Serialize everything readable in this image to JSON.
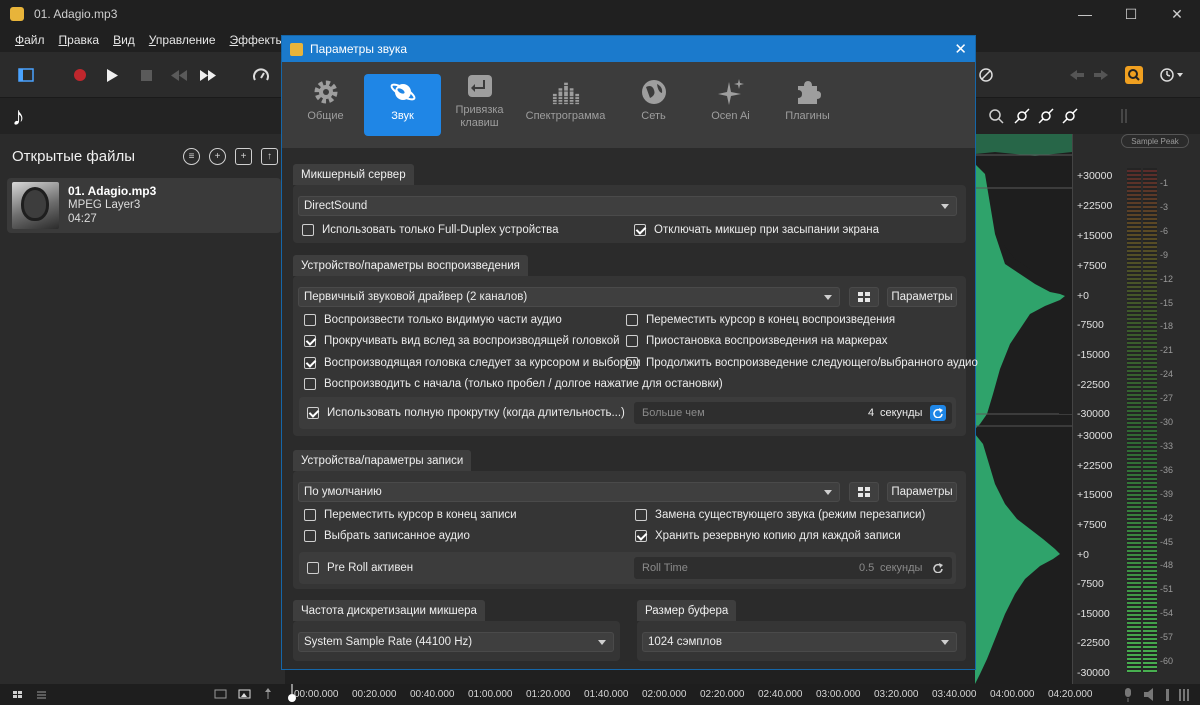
{
  "window": {
    "title": "01. Adagio.mp3",
    "min": "—",
    "max": "☐",
    "close": "✕"
  },
  "menu": [
    "Файл",
    "Правка",
    "Вид",
    "Управление",
    "Эффекты"
  ],
  "left_panel": {
    "title": "Открытые файлы",
    "file": {
      "name": "01. Adagio.mp3",
      "format": "MPEG Layer3",
      "duration": "04:27"
    }
  },
  "dialog": {
    "title": "Параметры звука",
    "close": "✕",
    "tabs": [
      {
        "label": "Общие",
        "icon": "gear-icon",
        "active": false
      },
      {
        "label": "Звук",
        "icon": "planet-icon",
        "active": true
      },
      {
        "label": "Привязка клавиш",
        "icon": "enter-key-icon",
        "active": false
      },
      {
        "label": "Спектрограмма",
        "icon": "spectrogram-icon",
        "active": false
      },
      {
        "label": "Сеть",
        "icon": "globe-icon",
        "active": false
      },
      {
        "label": "Ocen Ai",
        "icon": "sparkle-icon",
        "active": false
      },
      {
        "label": "Плагины",
        "icon": "puzzle-icon",
        "active": false
      }
    ],
    "mixer": {
      "header": "Микшерный сервер",
      "server": "DirectSound",
      "full_duplex": {
        "label": "Использовать только Full-Duplex устройства",
        "checked": false
      },
      "sleep_off": {
        "label": "Отключать микшер при засыпании экрана",
        "checked": true
      }
    },
    "playback": {
      "header": "Устройство/параметры воспроизведения",
      "device": "Первичный звуковой драйвер (2 каналов)",
      "params_button": "Параметры",
      "options_left": [
        {
          "label": "Воспроизвести только видимую части аудио",
          "checked": false
        },
        {
          "label": "Прокручивать вид вслед за воспроизводящей головкой",
          "checked": true
        },
        {
          "label": "Воспроизводящая головка следует за курсором и выбором",
          "checked": true
        },
        {
          "label": "Воспроизводить с начала (только пробел / долгое нажатие для остановки)",
          "checked": false
        }
      ],
      "options_right": [
        {
          "label": "Переместить курсор в конец воспроизведения",
          "checked": false
        },
        {
          "label": "Приостановка воспроизведения на маркерах",
          "checked": false
        },
        {
          "label": "Продолжить воспроизведение следующего/выбранного аудио",
          "checked": false
        }
      ],
      "full_scroll": {
        "label": "Использовать полную прокрутку (когда длительность...)",
        "checked": true
      },
      "more_than": "Больше чем",
      "seconds_value": "4",
      "seconds_unit": "секунды"
    },
    "record": {
      "header": "Устройства/параметры записи",
      "device": "По умолчанию",
      "params_button": "Параметры",
      "move_cursor": {
        "label": "Переместить курсор в конец записи",
        "checked": false
      },
      "select_recorded": {
        "label": "Выбрать записанное аудио",
        "checked": false
      },
      "overwrite": {
        "label": "Замена существующего звука (режим перезаписи)",
        "checked": false
      },
      "backup": {
        "label": "Хранить резервную копию для каждой записи",
        "checked": true
      },
      "preroll": {
        "label": "Pre Roll активен",
        "checked": false
      },
      "roll_time_label": "Roll Time",
      "roll_time_value": "0.5",
      "roll_time_unit": "секунды"
    },
    "sample_rate": {
      "header": "Частота дискретизации микшера",
      "value": "System Sample Rate (44100 Hz)"
    },
    "buffer": {
      "header": "Размер буфера",
      "value": "1024 сэмплов"
    }
  },
  "amplitude_scale": [
    "+30000",
    "+22500",
    "+15000",
    "+7500",
    "+0",
    "-7500",
    "-15000",
    "-22500",
    "-30000",
    "+30000",
    "+22500",
    "+15000",
    "+7500",
    "+0",
    "-7500",
    "-15000",
    "-22500",
    "-30000"
  ],
  "meter": {
    "button": "Sample Peak",
    "db_labels": [
      "-1",
      "-3",
      "-6",
      "-9",
      "-12",
      "-15",
      "-18",
      "-21",
      "-24",
      "-27",
      "-30",
      "-33",
      "-36",
      "-39",
      "-42",
      "-45",
      "-48",
      "-51",
      "-54",
      "-57",
      "-60"
    ]
  },
  "timeline": [
    "00:00.000",
    "00:20.000",
    "00:40.000",
    "01:00.000",
    "01:20.000",
    "01:40.000",
    "02:00.000",
    "02:20.000",
    "02:40.000",
    "03:00.000",
    "03:20.000",
    "03:40.000",
    "04:00.000",
    "04:20.000"
  ],
  "colors": {
    "accent": "#1f86e6",
    "titlebar": "#1b7acc",
    "waveform": "#2fa36b"
  }
}
